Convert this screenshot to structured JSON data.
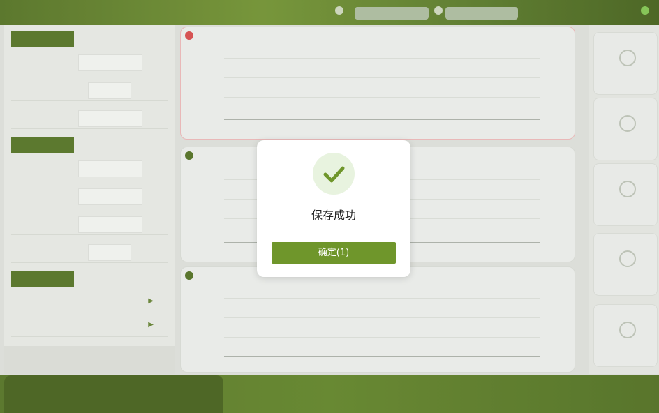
{
  "modal": {
    "message": "保存成功",
    "confirm_label": "确定(1)",
    "icon": "check-icon",
    "accent_color": "#6f962b"
  },
  "colors": {
    "brand_green": "#4f6e1e",
    "button_green": "#6f962b"
  }
}
